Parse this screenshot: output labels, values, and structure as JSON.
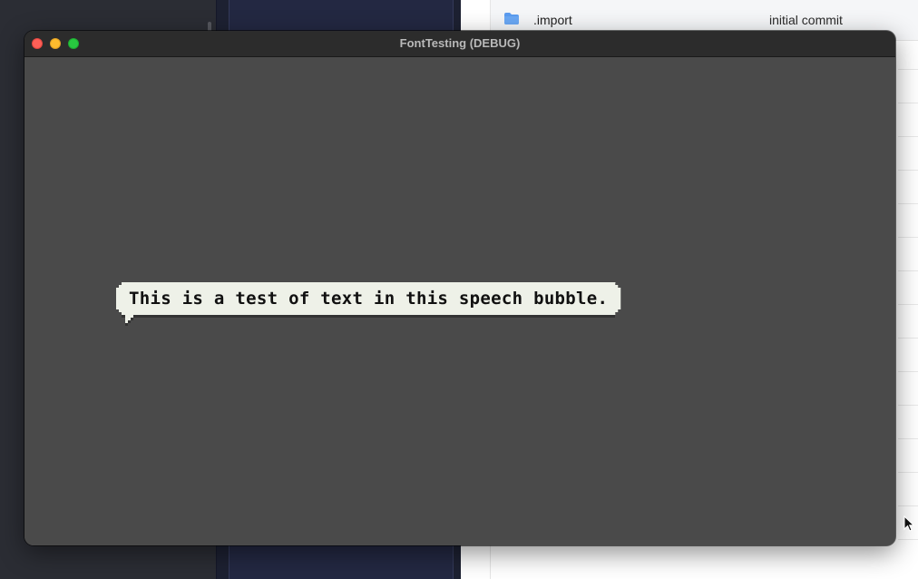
{
  "background_app": {
    "file_row": {
      "name": ".import",
      "commit_message": "initial commit",
      "icon": "folder-icon"
    }
  },
  "window": {
    "title": "FontTesting (DEBUG)",
    "controls": [
      "close",
      "minimize",
      "maximize"
    ],
    "canvas_color": "#4a4a4a"
  },
  "speech_bubble": {
    "text": "This is a test of text in this speech bubble.",
    "fill_color": "#eef1e8",
    "text_color": "#111111"
  },
  "colors": {
    "close": "#fe5f57",
    "minimize": "#febc2e",
    "maximize": "#28c840",
    "folder": "#5b9cf0"
  }
}
